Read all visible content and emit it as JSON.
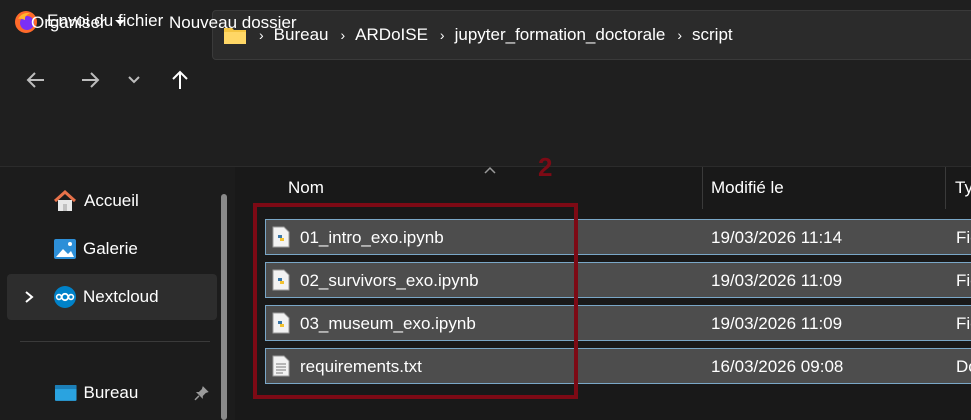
{
  "window": {
    "title": "Envoi du fichier"
  },
  "breadcrumbs": [
    "Bureau",
    "ARDoISE",
    "jupyter_formation_doctorale",
    "script"
  ],
  "toolbar": {
    "organize_label": "Organiser",
    "new_folder_label": "Nouveau dossier"
  },
  "sidebar": {
    "items": [
      {
        "label": "Accueil",
        "icon": "home-icon"
      },
      {
        "label": "Galerie",
        "icon": "gallery-icon"
      },
      {
        "label": "Nextcloud",
        "icon": "nextcloud-icon"
      },
      {
        "label": "Bureau",
        "icon": "desktop-icon"
      }
    ]
  },
  "columns": {
    "name": "Nom",
    "modified": "Modifié le",
    "type": "Ty"
  },
  "files": [
    {
      "name": "01_intro_exo.ipynb",
      "modified": "19/03/2026 11:14",
      "type": "Fic",
      "icon": "python-file-icon"
    },
    {
      "name": "02_survivors_exo.ipynb",
      "modified": "19/03/2026 11:09",
      "type": "Fic",
      "icon": "python-file-icon"
    },
    {
      "name": "03_museum_exo.ipynb",
      "modified": "19/03/2026 11:09",
      "type": "Fic",
      "icon": "python-file-icon"
    },
    {
      "name": "requirements.txt",
      "modified": "16/03/2026 09:08",
      "type": "Do",
      "icon": "text-file-icon"
    }
  ],
  "annotation": {
    "label": "2",
    "color": "#7d0a15"
  },
  "colors": {
    "selection_fill": "#4d4d4d",
    "selection_border": "#7aa7c7",
    "folder": "#f5c542"
  }
}
